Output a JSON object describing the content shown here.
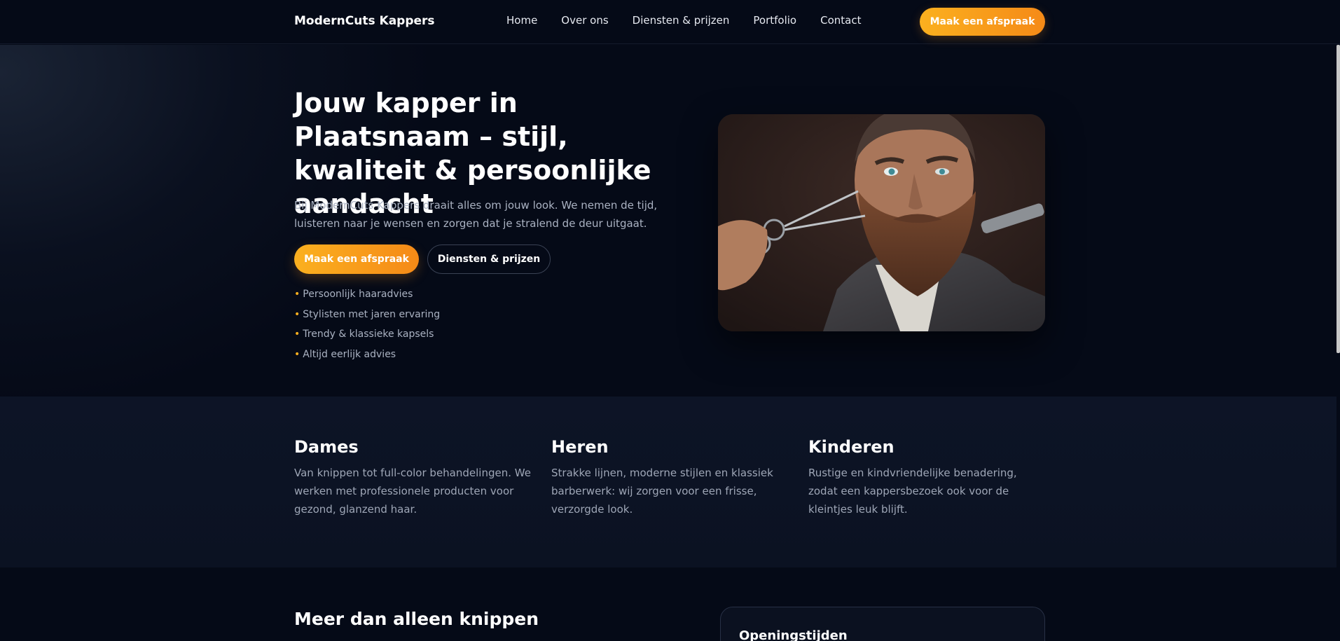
{
  "header": {
    "brand": "ModernCuts Kappers",
    "nav": [
      "Home",
      "Over ons",
      "Diensten & prijzen",
      "Portfolio",
      "Contact"
    ],
    "cta": "Maak een afspraak"
  },
  "hero": {
    "title": "Jouw kapper in Plaatsnaam – stijl, kwaliteit & persoonlijke aandacht",
    "text": "Bij ModernCuts Kappers draait alles om jouw look. We nemen de tijd, luisteren naar je wensen en zorgen dat je stralend de deur uitgaat.",
    "primary_button": "Maak een afspraak",
    "secondary_button": "Diensten & prijzen",
    "bullet_symbol": "•",
    "bullets": [
      "Persoonlijk haaradvies",
      "Stylisten met jaren ervaring",
      "Trendy & klassieke kapsels",
      "Altijd eerlijk advies"
    ]
  },
  "services": [
    {
      "title": "Dames",
      "text": "Van knippen tot full-color behandelingen. We werken met professionele producten voor gezond, glanzend haar."
    },
    {
      "title": "Heren",
      "text": "Strakke lijnen, moderne stijlen en klassiek barberwerk: wij zorgen voor een frisse, verzorgde look."
    },
    {
      "title": "Kinderen",
      "text": "Rustige en kindvriendelijke benadering, zodat een kappersbezoek ook voor de kleintjes leuk blijft."
    }
  ],
  "bottom": {
    "title": "Meer dan alleen knippen",
    "hours_title": "Openingstijden"
  },
  "colors": {
    "accent_start": "#fbb01f",
    "accent_end": "#f58a17",
    "background": "#050a17"
  }
}
